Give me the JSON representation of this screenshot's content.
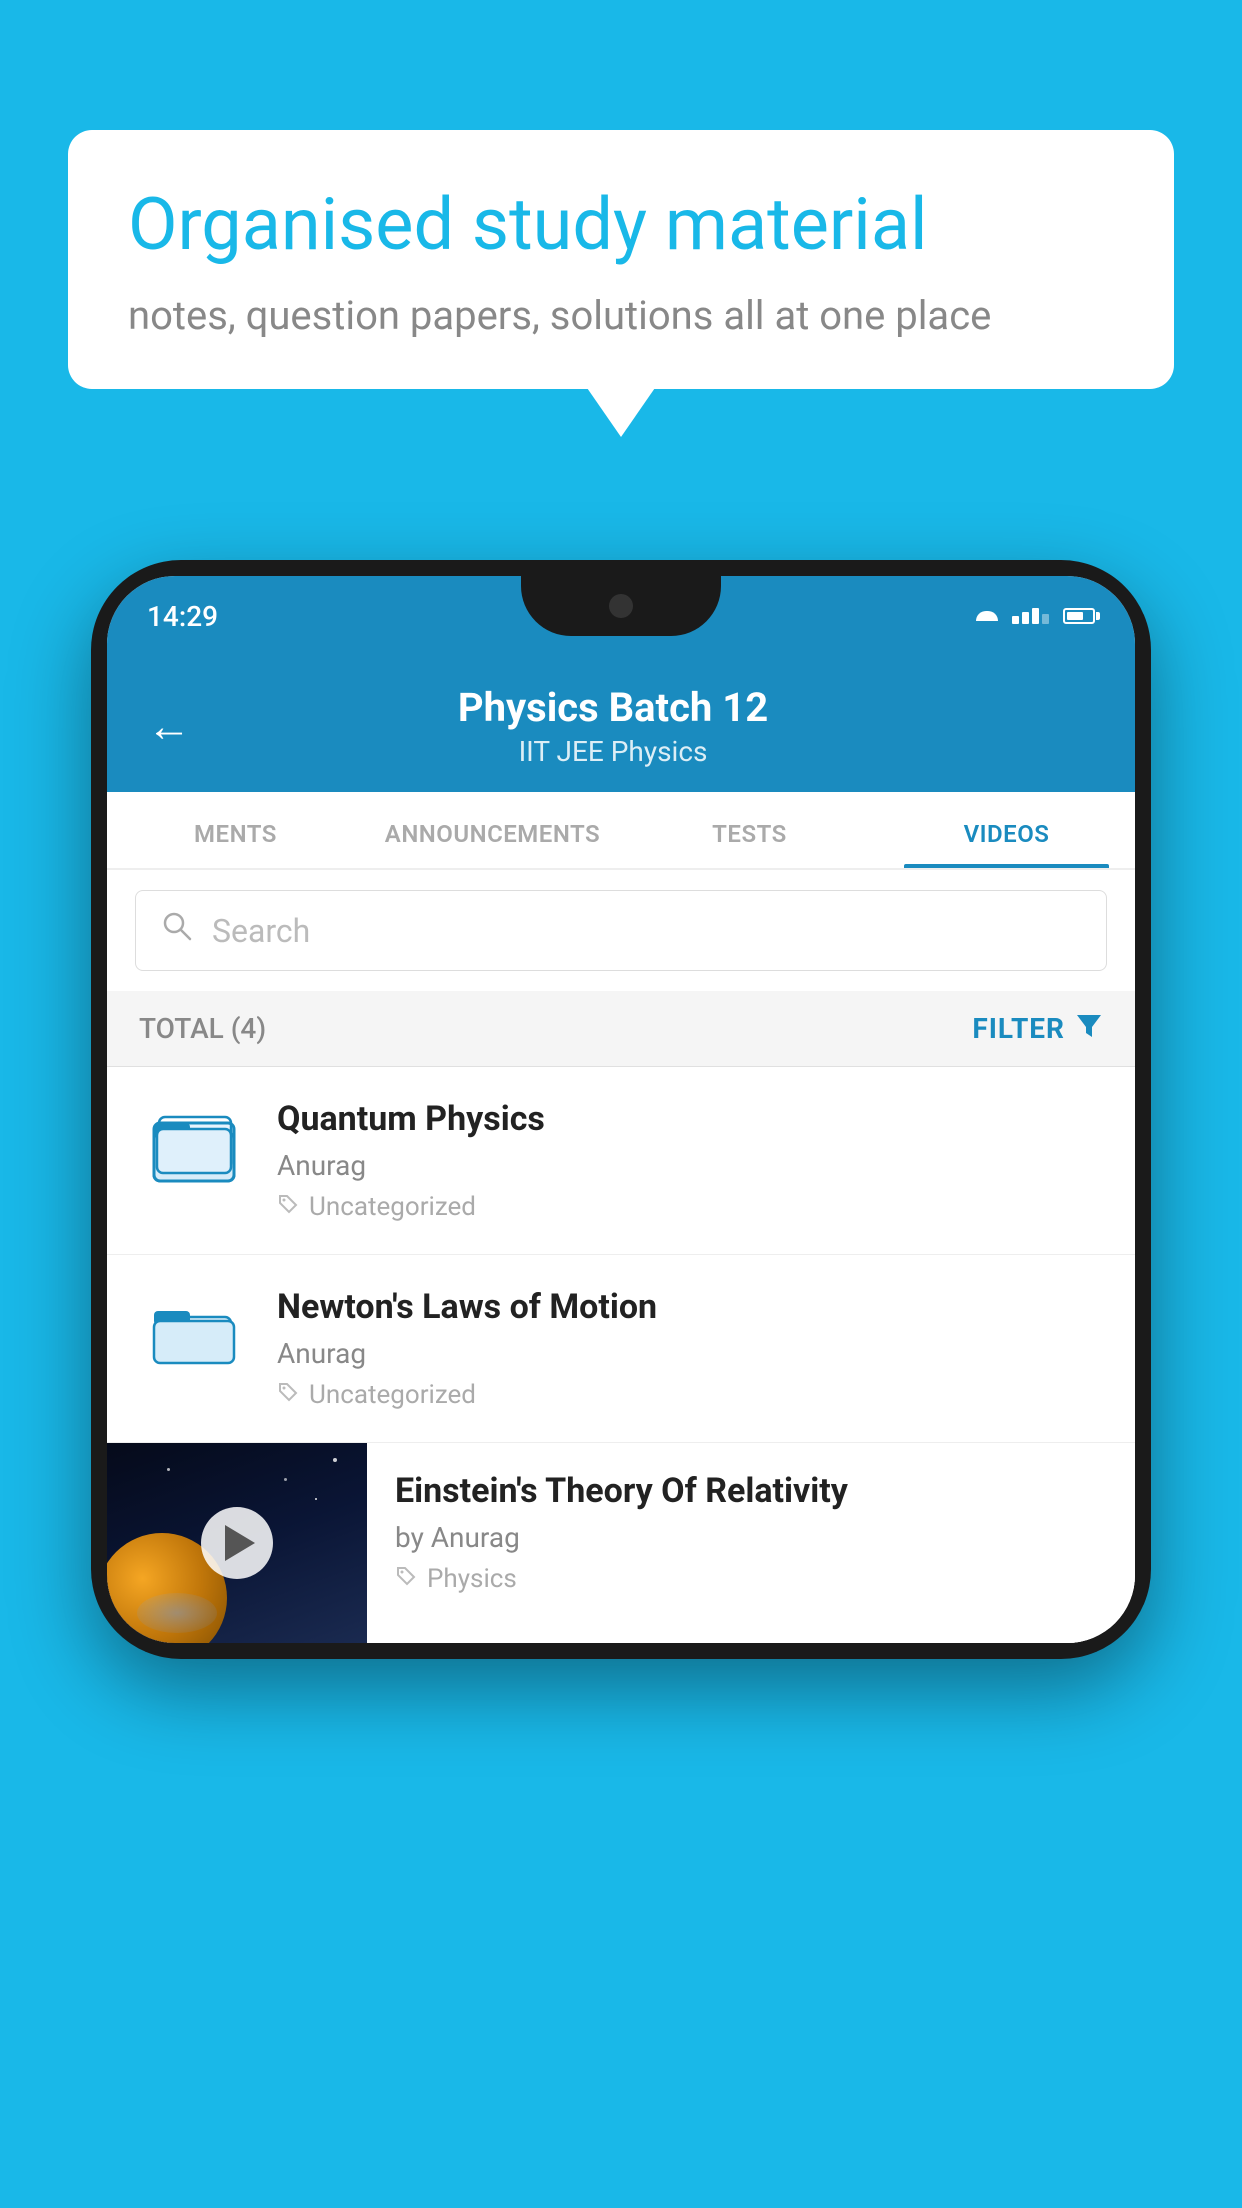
{
  "background_color": "#19b8e8",
  "speech_bubble": {
    "title": "Organised study material",
    "subtitle": "notes, question papers, solutions all at one place"
  },
  "phone": {
    "status_bar": {
      "time": "14:29"
    },
    "app_header": {
      "back_label": "←",
      "title": "Physics Batch 12",
      "subtitle_part1": "IIT JEE",
      "subtitle_separator": "  ",
      "subtitle_part2": "Physics"
    },
    "tabs": [
      {
        "label": "MENTS",
        "active": false
      },
      {
        "label": "ANNOUNCEMENTS",
        "active": false
      },
      {
        "label": "TESTS",
        "active": false
      },
      {
        "label": "VIDEOS",
        "active": true
      }
    ],
    "search": {
      "placeholder": "Search"
    },
    "filter": {
      "total_label": "TOTAL (4)",
      "filter_label": "FILTER"
    },
    "videos": [
      {
        "title": "Quantum Physics",
        "author": "Anurag",
        "tag": "Uncategorized",
        "has_thumbnail": false
      },
      {
        "title": "Newton's Laws of Motion",
        "author": "Anurag",
        "tag": "Uncategorized",
        "has_thumbnail": false
      },
      {
        "title": "Einstein's Theory Of Relativity",
        "author": "by Anurag",
        "tag": "Physics",
        "has_thumbnail": true
      }
    ]
  }
}
